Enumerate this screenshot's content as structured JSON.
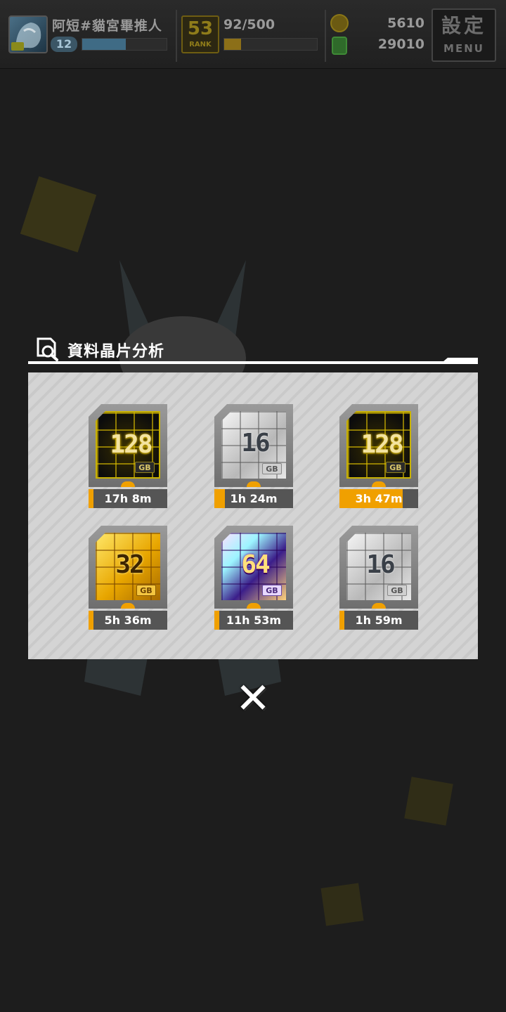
{
  "topbar": {
    "player_name": "阿短#貓宮畢推人",
    "level": "12",
    "exp_fraction": 0.52,
    "rank": "53",
    "rank_label": "RANK",
    "stamina": "92/500",
    "stamina_fraction": 0.18,
    "coins": "5610",
    "gems": "29010",
    "menu_kanji": "設定",
    "menu_label": "MENU"
  },
  "dialog": {
    "title": "資料晶片分析",
    "chips": [
      {
        "capacity": "128",
        "unit": "GB",
        "style": "black",
        "timer": "17h 8m",
        "progress": 0.05
      },
      {
        "capacity": "16",
        "unit": "GB",
        "style": "silver",
        "timer": "1h 24m",
        "progress": 0.13
      },
      {
        "capacity": "128",
        "unit": "GB",
        "style": "black",
        "timer": "3h 47m",
        "progress": 0.8
      },
      {
        "capacity": "32",
        "unit": "GB",
        "style": "gold",
        "timer": "5h 36m",
        "progress": 0.05
      },
      {
        "capacity": "64",
        "unit": "GB",
        "style": "holo",
        "timer": "11h 53m",
        "progress": 0.02
      },
      {
        "capacity": "16",
        "unit": "GB",
        "style": "silver",
        "timer": "1h 59m",
        "progress": 0.0
      }
    ],
    "close_symbol": "✕"
  },
  "colors": {
    "accent": "#f0a000",
    "panel": "#d4d4d4",
    "overlay": "#1d1d1d"
  }
}
